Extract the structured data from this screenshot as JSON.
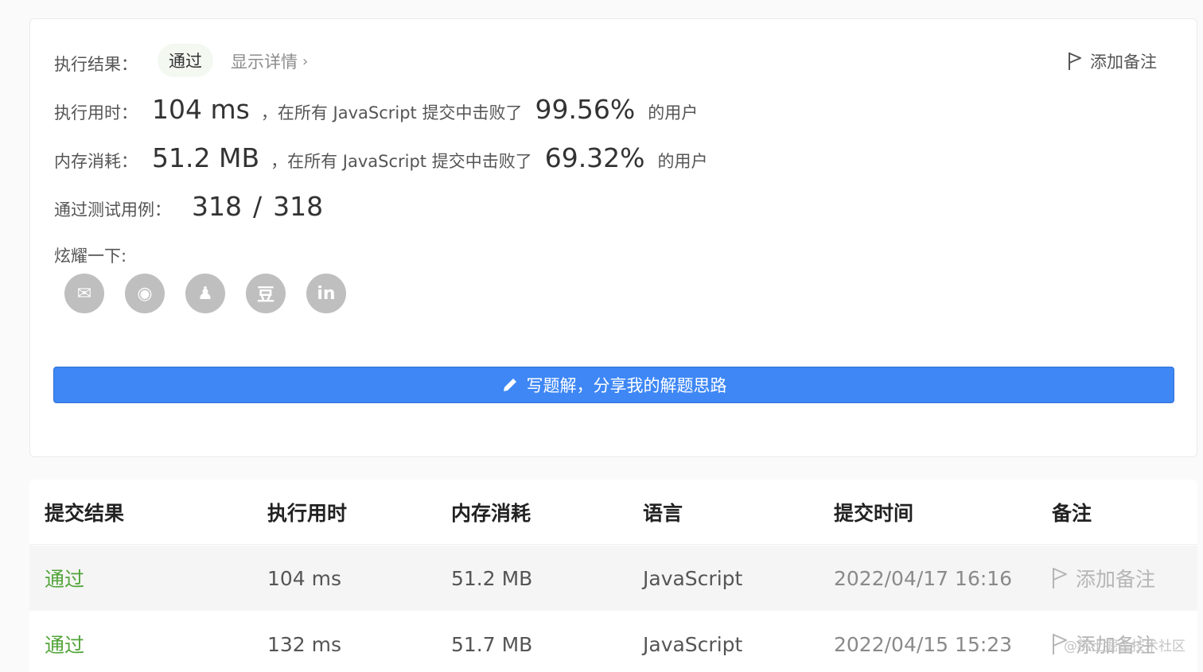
{
  "result_card": {
    "status_label": "执行结果：",
    "status_value": "通过",
    "details_link": "显示详情",
    "add_note": "添加备注",
    "runtime": {
      "label": "执行用时：",
      "value": "104 ms",
      "prefix": "，在所有 JavaScript 提交中击败了",
      "percent": "99.56%",
      "suffix": "的用户"
    },
    "memory": {
      "label": "内存消耗：",
      "value": "51.2 MB",
      "prefix": "，在所有 JavaScript 提交中击败了",
      "percent": "69.32%",
      "suffix": "的用户"
    },
    "testcases": {
      "label": "通过测试用例：",
      "passed": "318",
      "sep": "/",
      "total": "318"
    },
    "share_label": "炫耀一下:",
    "share_buttons": [
      {
        "name": "wechat-icon",
        "glyph": "✉"
      },
      {
        "name": "weibo-icon",
        "glyph": "◉"
      },
      {
        "name": "qq-icon",
        "glyph": "♟"
      },
      {
        "name": "douban-icon",
        "glyph": "豆"
      },
      {
        "name": "linkedin-icon",
        "glyph": "in"
      }
    ],
    "write_solution": "写题解，分享我的解题思路"
  },
  "submissions": {
    "headers": [
      "提交结果",
      "执行用时",
      "内存消耗",
      "语言",
      "提交时间",
      "备注"
    ],
    "rows": [
      {
        "result": "通过",
        "runtime": "104 ms",
        "memory": "51.2 MB",
        "language": "JavaScript",
        "time": "2022/04/17 16:16",
        "note": "添加备注"
      },
      {
        "result": "通过",
        "runtime": "132 ms",
        "memory": "51.7 MB",
        "language": "JavaScript",
        "time": "2022/04/15 15:23",
        "note": "添加备注"
      }
    ]
  },
  "watermark": "@稀土掘金技术社区",
  "colors": {
    "accent": "#3e87f5",
    "pass": "#52a53b"
  }
}
